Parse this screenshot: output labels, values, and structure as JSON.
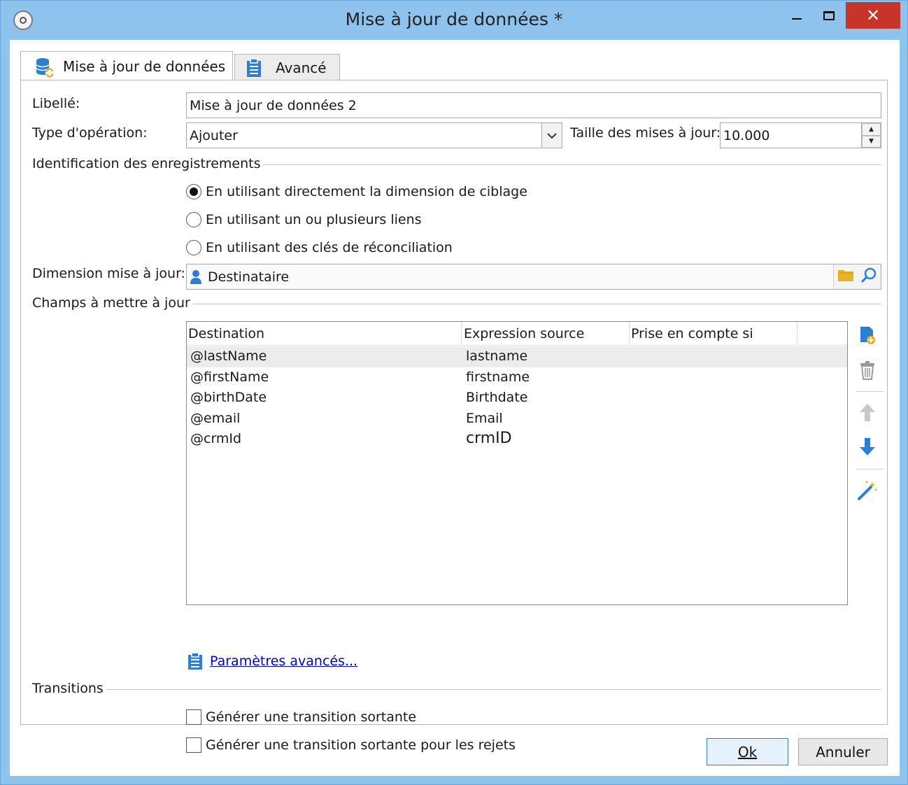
{
  "window": {
    "title": "Mise à jour de données *",
    "close_symbol": "✕"
  },
  "tabs": [
    {
      "label": "Mise à jour de données",
      "icon": "database-sync-icon",
      "active": true
    },
    {
      "label": "Avancé",
      "icon": "clipboard-icon",
      "active": false
    }
  ],
  "form": {
    "label_libelle": "Libellé:",
    "libelle_value": "Mise à jour de données 2",
    "label_type": "Type d'opération:",
    "type_value": "Ajouter",
    "label_taille": "Taille des mises à jour:",
    "taille_value": "10.000",
    "section_identification": "Identification des enregistrements",
    "radios": [
      {
        "label": "En utilisant directement la dimension de ciblage",
        "checked": true
      },
      {
        "label": "En utilisant un ou plusieurs liens",
        "checked": false
      },
      {
        "label": "En utilisant des clés de réconciliation",
        "checked": false
      }
    ],
    "label_dimension": "Dimension mise à jour:",
    "dimension_value": "Destinataire",
    "section_champs": "Champs à mettre à jour"
  },
  "grid": {
    "columns": [
      "Destination",
      "Expression source",
      "Prise en compte si"
    ],
    "rows": [
      {
        "destination": "@lastName",
        "source": "lastname",
        "condition": "",
        "selected": true
      },
      {
        "destination": "@firstName",
        "source": "firstname",
        "condition": "",
        "selected": false
      },
      {
        "destination": "@birthDate",
        "source": "Birthdate",
        "condition": "",
        "selected": false
      },
      {
        "destination": "@email",
        "source": "Email",
        "condition": "",
        "selected": false
      },
      {
        "destination": "@crmId",
        "source": "crmID",
        "condition": "",
        "selected": false
      }
    ]
  },
  "tools": [
    "add-field-icon",
    "delete-icon",
    "move-up-icon",
    "move-down-icon",
    "magic-wand-icon"
  ],
  "advanced_link": "Paramètres avancés...",
  "transitions": {
    "section": "Transitions",
    "checkboxes": [
      {
        "label": "Générer une transition sortante",
        "checked": false
      },
      {
        "label": "Générer une transition sortante pour les rejets",
        "checked": false
      }
    ]
  },
  "buttons": {
    "ok_label": "Ok",
    "cancel_label": "Annuler"
  },
  "colors": {
    "title_bar": "#8ec3ee",
    "close_button": "#c7342a",
    "link": "#0000cc",
    "icon_blue": "#2d7fd3",
    "icon_orange": "#f5a623"
  }
}
